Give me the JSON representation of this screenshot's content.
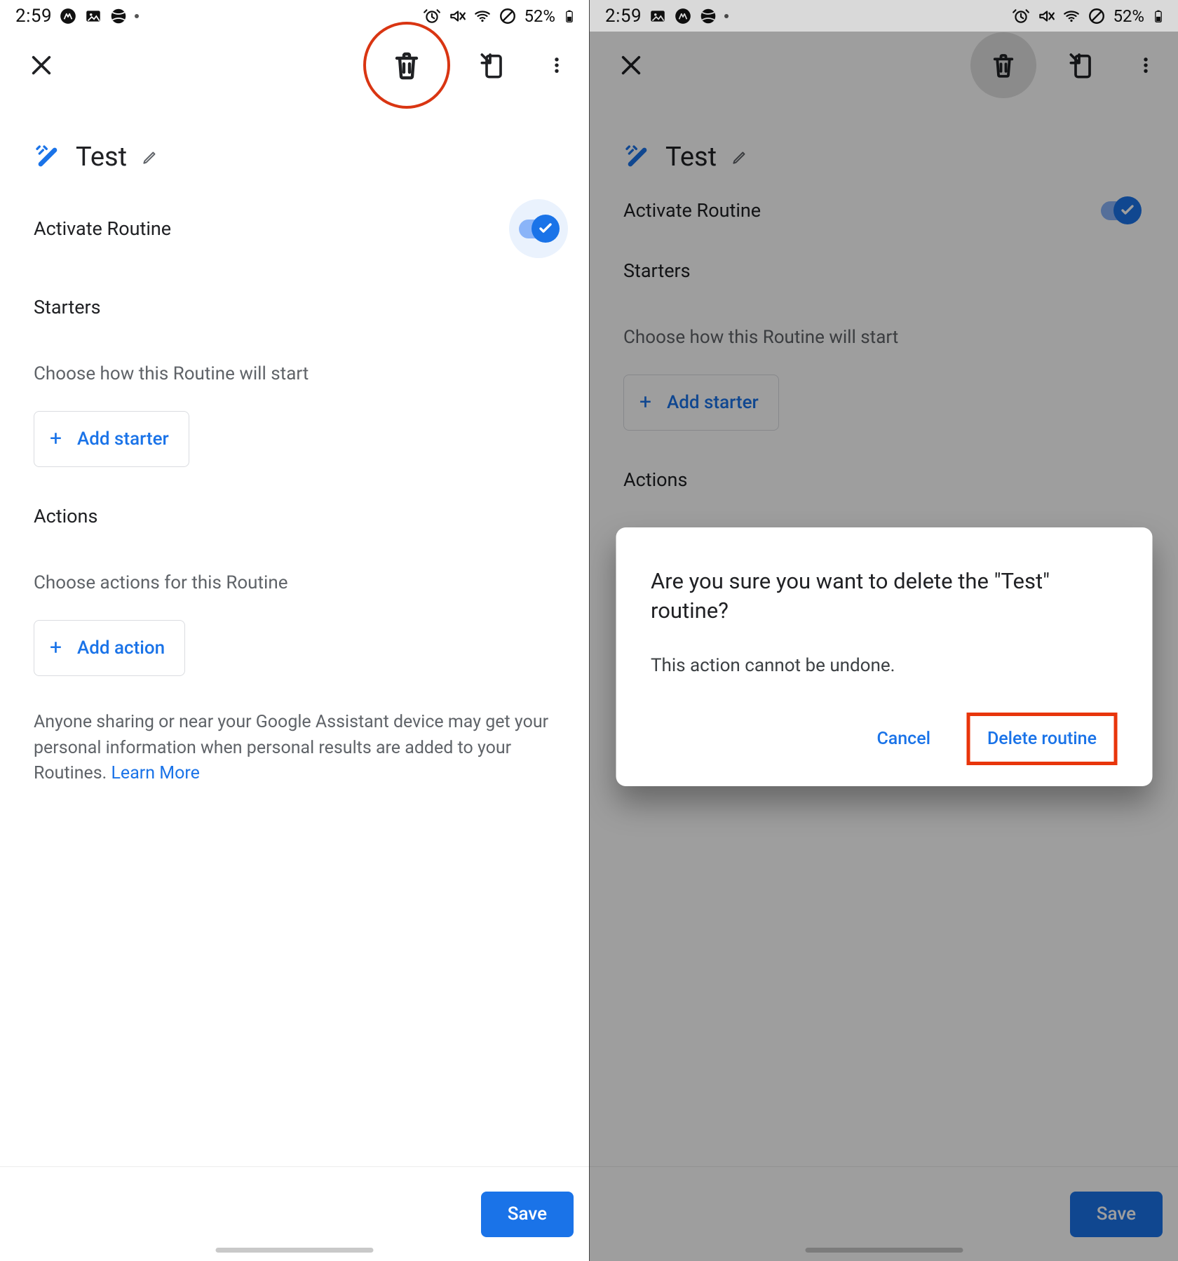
{
  "status": {
    "time": "2:59",
    "battery": "52%"
  },
  "routine": {
    "name": "Test",
    "activate_label": "Activate Routine",
    "starters_h": "Starters",
    "starters_desc": "Choose how this Routine will start",
    "add_starter": "Add starter",
    "actions_h": "Actions",
    "actions_desc": "Choose actions for this Routine",
    "add_action": "Add action",
    "footnote": "Anyone sharing or near your Google Assistant device may get your personal information when personal results are added to your Routines. ",
    "learn_more": "Learn More"
  },
  "footer": {
    "save": "Save"
  },
  "dialog": {
    "title": "Are you sure you want to delete the \"Test\" routine?",
    "body": "This action cannot be undone.",
    "cancel": "Cancel",
    "confirm": "Delete routine"
  }
}
